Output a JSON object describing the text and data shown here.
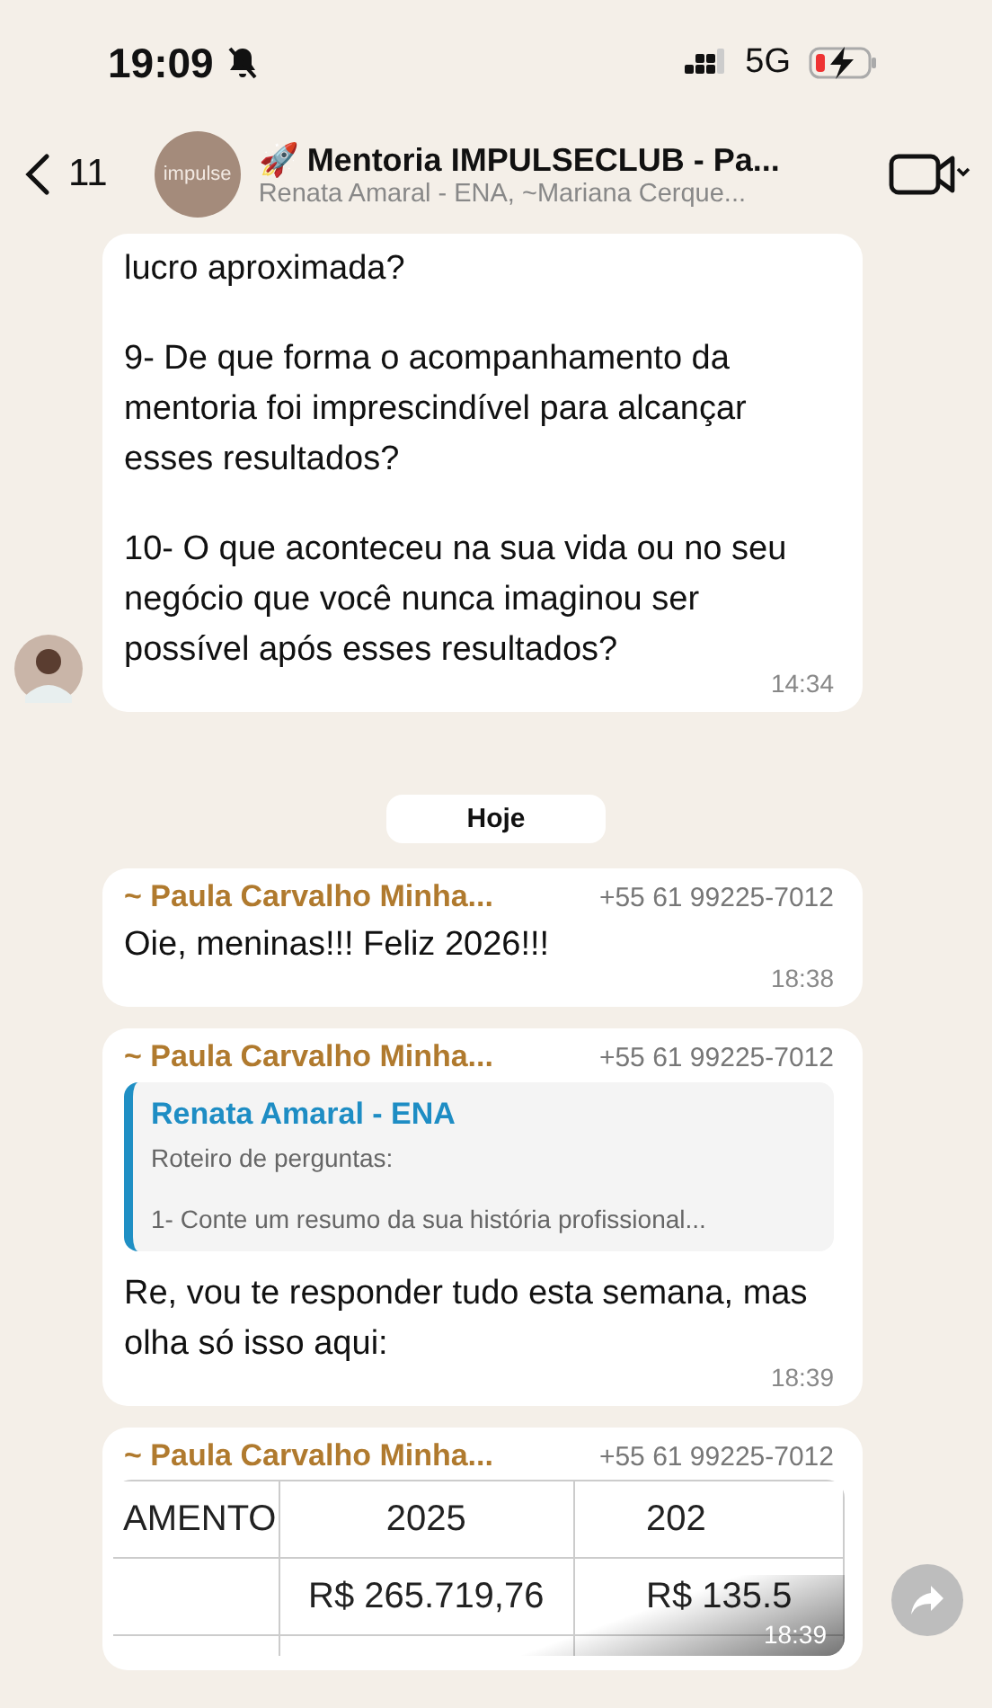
{
  "status_bar": {
    "time": "19:09",
    "network": "5G"
  },
  "header": {
    "back_count": "11",
    "avatar_text": "impulse",
    "title": "🚀 Mentoria IMPULSECLUB - Pa...",
    "subtitle": "Renata Amaral - ENA, ~Mariana Cerque..."
  },
  "messages": [
    {
      "kind": "text",
      "paragraphs": [
        "lucro aproximada?",
        "9- De que forma o acompanhamento da mentoria foi imprescindível para alcançar esses resultados?",
        "10- O que aconteceu na sua vida ou no seu negócio que você nunca imaginou ser possível após esses resultados?"
      ],
      "time": "14:34",
      "avatar": true
    },
    {
      "kind": "date",
      "label": "Hoje"
    },
    {
      "kind": "text",
      "sender": "~ Paula Carvalho Minha...",
      "phone": "+55 61 99225-7012",
      "paragraphs": [
        "Oie, meninas!!! Feliz 2026!!!"
      ],
      "time": "18:38",
      "avatar": false
    },
    {
      "kind": "quote",
      "sender": "~ Paula Carvalho Minha...",
      "phone": "+55 61 99225-7012",
      "quote_author": "Renata Amaral - ENA",
      "quote_paragraphs": [
        "Roteiro de perguntas:",
        "1- Conte um resumo da sua história profissional..."
      ],
      "paragraphs": [
        "Re, vou te responder tudo esta semana, mas olha só isso aqui:"
      ],
      "time": "18:39"
    },
    {
      "kind": "image",
      "sender": "~ Paula Carvalho Minha...",
      "phone": "+55 61 99225-7012",
      "table": [
        {
          "column_1": "AMENTO",
          "column_2": "2025",
          "column_3": "202"
        },
        {
          "column_2": "R$ 265.719,76",
          "column_3": "R$ 135.5"
        }
      ],
      "time": "18:39"
    }
  ]
}
